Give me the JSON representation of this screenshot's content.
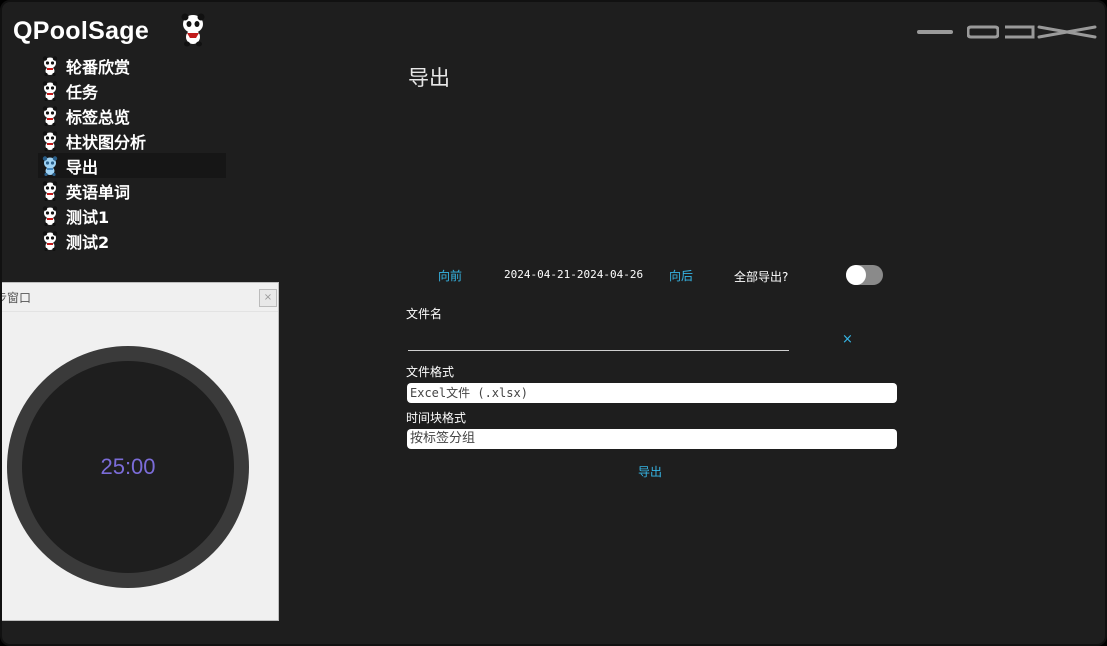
{
  "app": {
    "title": "QPoolSage"
  },
  "window_controls": [
    "minimize-icon",
    "restore-icon",
    "maximize-icon",
    "close-icon"
  ],
  "nav": {
    "items": [
      {
        "label": "轮番欣赏",
        "active": false
      },
      {
        "label": "任务",
        "active": false
      },
      {
        "label": "标签总览",
        "active": false
      },
      {
        "label": "柱状图分析",
        "active": false
      },
      {
        "label": "导出",
        "active": true
      },
      {
        "label": "英语单词",
        "active": false
      },
      {
        "label": "测试1",
        "active": false
      },
      {
        "label": "测试2",
        "active": false
      }
    ]
  },
  "page": {
    "title": "导出",
    "prev_label": "向前",
    "date_range": "2024-04-21-2024-04-26",
    "next_label": "向后",
    "export_all_label": "全部导出?",
    "export_all_on": false,
    "filename_label": "文件名",
    "filename_value": "",
    "clear_glyph": "×",
    "format_label": "文件格式",
    "format_value": "Excel文件 (.xlsx)",
    "timeblock_label": "时间块格式",
    "timeblock_value": "按标签分组",
    "export_button": "导出"
  },
  "float_window": {
    "title": "步窗口",
    "close_glyph": "×",
    "timer": "25:00"
  },
  "colors": {
    "background": "#1e1e1e",
    "accent": "#36b6e6",
    "timer_text": "#7b6cd8",
    "ring": "#3a3a3a"
  }
}
